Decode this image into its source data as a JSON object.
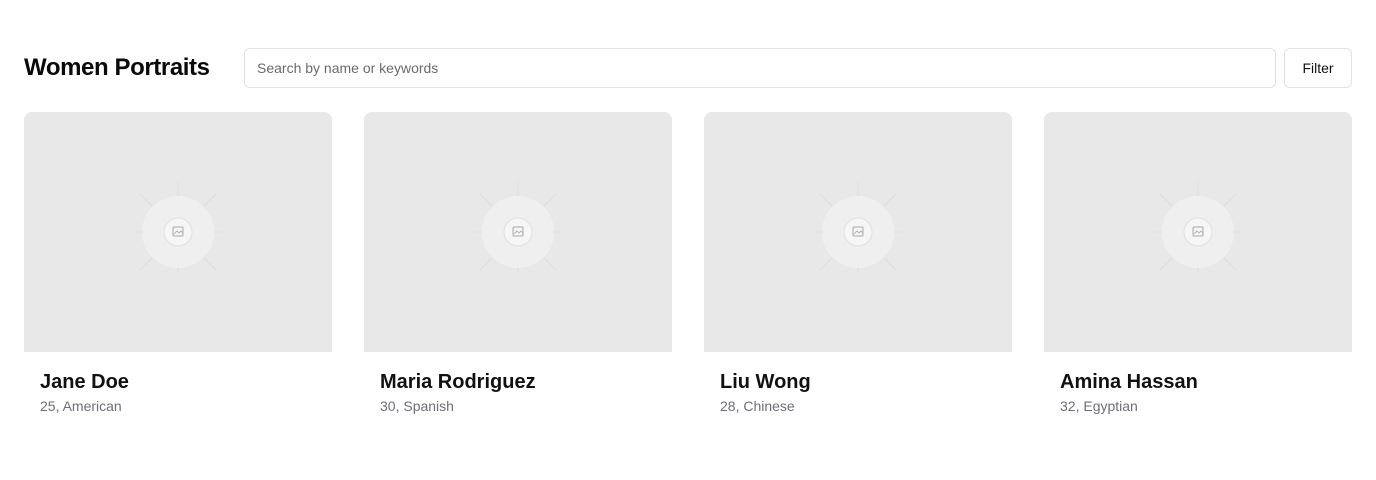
{
  "header": {
    "title": "Women Portraits",
    "search_placeholder": "Search by name or keywords",
    "search_value": "",
    "filter_label": "Filter"
  },
  "cards": [
    {
      "name": "Jane Doe",
      "meta": "25, American",
      "image_icon": "image-placeholder-icon"
    },
    {
      "name": "Maria Rodriguez",
      "meta": "30, Spanish",
      "image_icon": "image-placeholder-icon"
    },
    {
      "name": "Liu Wong",
      "meta": "28, Chinese",
      "image_icon": "image-placeholder-icon"
    },
    {
      "name": "Amina Hassan",
      "meta": "32, Egyptian",
      "image_icon": "image-placeholder-icon"
    }
  ],
  "colors": {
    "placeholder_bg": "#e8e8e8",
    "meta_text": "#6e6e78",
    "border": "#e2e2e2"
  }
}
